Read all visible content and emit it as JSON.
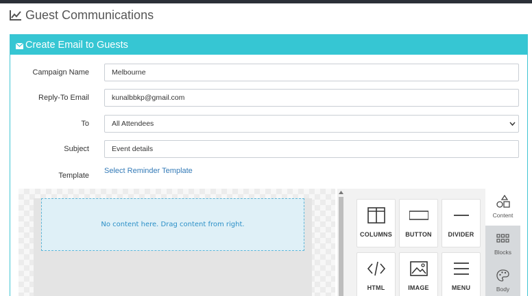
{
  "page": {
    "title": "Guest Communications",
    "title_icon": "line-chart-icon"
  },
  "panel": {
    "heading": "Create Email to Guests",
    "heading_icon": "envelope-icon",
    "accent_color": "#36c6d3"
  },
  "form": {
    "campaign_name": {
      "label": "Campaign Name",
      "value": "Melbourne"
    },
    "reply_to": {
      "label": "Reply-To Email",
      "value": "kunalbbkp@gmail.com"
    },
    "to": {
      "label": "To",
      "value": "All Attendees"
    },
    "subject": {
      "label": "Subject",
      "value": "Event details"
    },
    "template": {
      "label": "Template",
      "link": "Select Reminder Template"
    }
  },
  "editor": {
    "empty_message": "No content here. Drag content from right.",
    "tools": [
      {
        "label": "COLUMNS",
        "icon": "columns-icon"
      },
      {
        "label": "BUTTON",
        "icon": "button-icon"
      },
      {
        "label": "DIVIDER",
        "icon": "divider-icon"
      },
      {
        "label": "HTML",
        "icon": "code-icon"
      },
      {
        "label": "IMAGE",
        "icon": "image-icon"
      },
      {
        "label": "MENU",
        "icon": "menu-icon"
      }
    ],
    "side_tabs": [
      {
        "label": "Content",
        "icon": "shapes-icon"
      },
      {
        "label": "Blocks",
        "icon": "blocks-icon"
      },
      {
        "label": "Body",
        "icon": "palette-icon"
      }
    ]
  }
}
